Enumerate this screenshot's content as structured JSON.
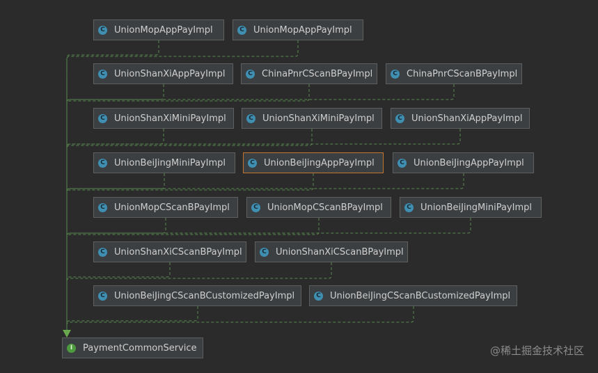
{
  "colors": {
    "background": "#2b2b2b",
    "node_fill": "#3c3f41",
    "node_border": "#5e6060",
    "selected_border": "#c6752e",
    "class_badge": "#3f8fb3",
    "interface_badge": "#4d9a3f",
    "edge": "#5a8a4f"
  },
  "nodes": [
    {
      "id": "n1",
      "label": "UnionMopAppPayImpl",
      "badge": "C",
      "kind": "class"
    },
    {
      "id": "n2",
      "label": "UnionMopAppPayImpl",
      "badge": "C",
      "kind": "class"
    },
    {
      "id": "n3",
      "label": "UnionShanXiAppPayImpl",
      "badge": "C",
      "kind": "class"
    },
    {
      "id": "n4",
      "label": "ChinaPnrCScanBPayImpl",
      "badge": "C",
      "kind": "class"
    },
    {
      "id": "n5",
      "label": "ChinaPnrCScanBPayImpl",
      "badge": "C",
      "kind": "class"
    },
    {
      "id": "n6",
      "label": "UnionShanXiMiniPayImpl",
      "badge": "C",
      "kind": "class"
    },
    {
      "id": "n7",
      "label": "UnionShanXiMiniPayImpl",
      "badge": "C",
      "kind": "class"
    },
    {
      "id": "n8",
      "label": "UnionShanXiAppPayImpl",
      "badge": "C",
      "kind": "class"
    },
    {
      "id": "n9",
      "label": "UnionBeiJingMiniPayImpl",
      "badge": "C",
      "kind": "class"
    },
    {
      "id": "n10",
      "label": "UnionBeiJingAppPayImpl",
      "badge": "C",
      "kind": "class",
      "selected": true
    },
    {
      "id": "n11",
      "label": "UnionBeiJingAppPayImpl",
      "badge": "C",
      "kind": "class"
    },
    {
      "id": "n12",
      "label": "UnionMopCScanBPayImpl",
      "badge": "C",
      "kind": "class"
    },
    {
      "id": "n13",
      "label": "UnionMopCScanBPayImpl",
      "badge": "C",
      "kind": "class"
    },
    {
      "id": "n14",
      "label": "UnionBeiJingMiniPayImpl",
      "badge": "C",
      "kind": "class"
    },
    {
      "id": "n15",
      "label": "UnionShanXiCScanBPayImpl",
      "badge": "C",
      "kind": "class"
    },
    {
      "id": "n16",
      "label": "UnionShanXiCScanBPayImpl",
      "badge": "C",
      "kind": "class"
    },
    {
      "id": "n17",
      "label": "UnionBeiJingCScanBCustomizedPayImpl",
      "badge": "C",
      "kind": "class"
    },
    {
      "id": "n18",
      "label": "UnionBeiJingCScanBCustomizedPayImpl",
      "badge": "C",
      "kind": "class"
    },
    {
      "id": "target",
      "label": "PaymentCommonService",
      "badge": "I",
      "kind": "interface"
    }
  ],
  "watermark": "@稀土掘金技术社区"
}
